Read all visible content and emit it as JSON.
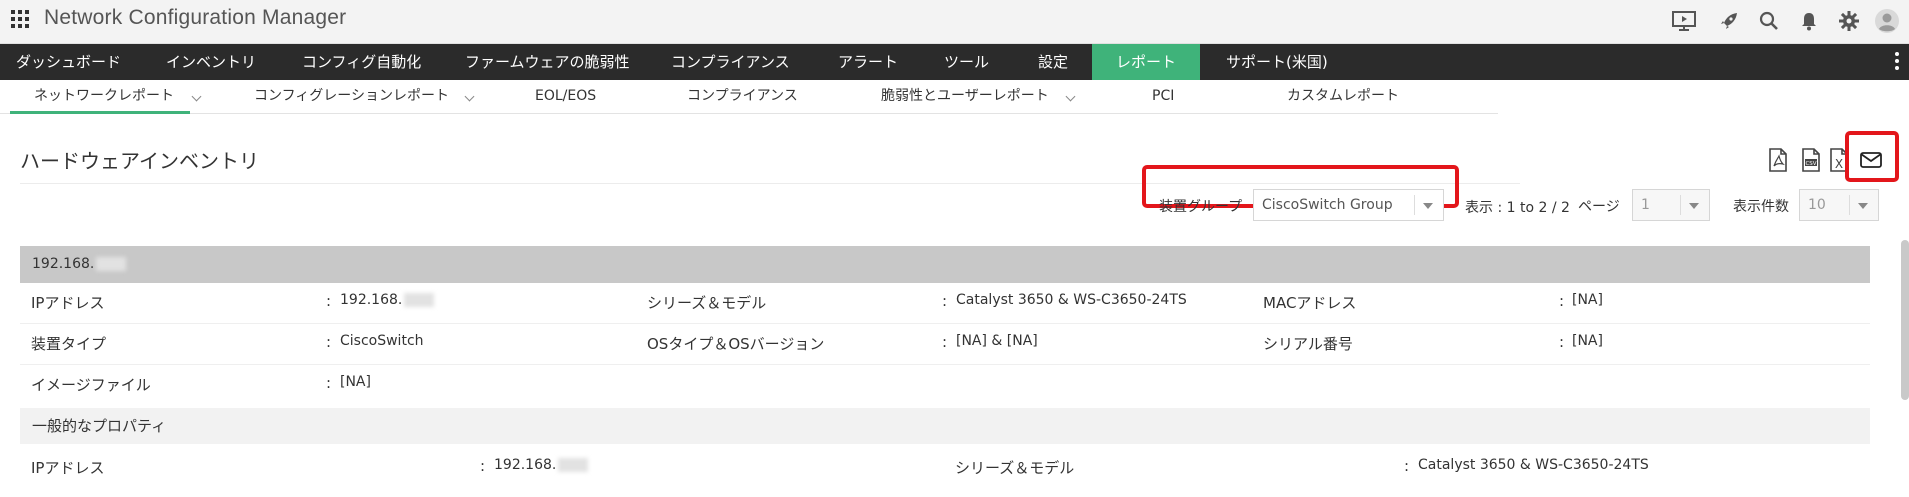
{
  "app": {
    "title": "Network Configuration Manager"
  },
  "top_icons": [
    "presentation-icon",
    "rocket-icon",
    "search-icon",
    "bell-icon",
    "gear-icon",
    "user-avatar-icon"
  ],
  "main_nav": [
    "ダッシュボード",
    "インベントリ",
    "コンフィグ自動化",
    "ファームウェアの脆弱性",
    "コンプライアンス",
    "アラート",
    "ツール",
    "設定",
    "レポート",
    "サポート(米国)"
  ],
  "main_nav_active": "レポート",
  "sub_nav": [
    "ネットワークレポート",
    "コンフィグレーションレポート",
    "EOL/EOS",
    "コンプライアンス",
    "脆弱性とユーザーレポート",
    "PCI",
    "カスタムレポート"
  ],
  "page": {
    "title": "ハードウェアインベントリ"
  },
  "export_icons": [
    "pdf-icon",
    "csv-icon",
    "xls-icon",
    "mail-icon"
  ],
  "filters": {
    "device_group_label": "装置グループ",
    "device_group_value": "CiscoSwitch Group",
    "display_text": "表示 : 1 to 2 / 2",
    "page_label": "ページ",
    "page_value": "1",
    "per_page_label": "表示件数",
    "per_page_value": "10"
  },
  "device": {
    "header": "192.168.",
    "rows": [
      [
        {
          "key": "IPアドレス",
          "value": "192.168.",
          "blurred": true
        },
        {
          "key": "シリーズ＆モデル",
          "value": "Catalyst 3650 & WS-C3650-24TS"
        },
        {
          "key": "MACアドレス",
          "value": "[NA]"
        }
      ],
      [
        {
          "key": "装置タイプ",
          "value": "CiscoSwitch"
        },
        {
          "key": "OSタイプ＆OSバージョン",
          "value": "[NA] & [NA]"
        },
        {
          "key": "シリアル番号",
          "value": "[NA]"
        }
      ],
      [
        {
          "key": "イメージファイル",
          "value": "[NA]"
        }
      ]
    ],
    "general_section": "一般的なプロパティ",
    "general_row": [
      {
        "key": "IPアドレス",
        "value": "192.168.",
        "blurred": true
      },
      {
        "key": "シリーズ＆モデル",
        "value": "Catalyst 3650 & WS-C3650-24TS"
      }
    ]
  },
  "colors": {
    "accent": "#3fb37a",
    "nav_bg": "#2b2b2b",
    "highlight": "#e3161b"
  }
}
